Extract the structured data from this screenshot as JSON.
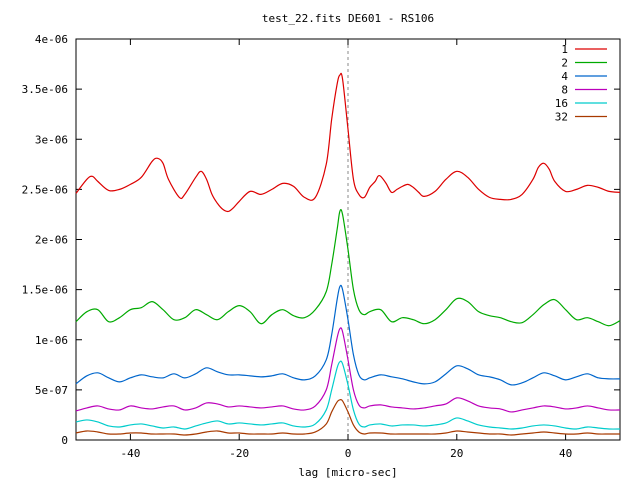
{
  "chart_data": {
    "type": "line",
    "title": "test_22.fits  DE601 - RS106",
    "xlabel": "lag [micro-sec]",
    "ylabel": "",
    "xlim": [
      -50,
      50
    ],
    "ylim": [
      0,
      4e-06
    ],
    "x_ticks": [
      -40,
      -20,
      0,
      20,
      40
    ],
    "x_tick_labels": [
      "-40",
      "-20",
      "0",
      "20",
      "40"
    ],
    "y_ticks": [
      0,
      5e-07,
      1e-06,
      1.5e-06,
      2e-06,
      2.5e-06,
      3e-06,
      3.5e-06,
      4e-06
    ],
    "y_tick_labels": [
      "0",
      "5e-07",
      "1e-06",
      "1.5e-06",
      "2e-06",
      "2.5e-06",
      "3e-06",
      "3.5e-06",
      "4e-06"
    ],
    "zero_line": true,
    "grid": false,
    "legend_position": "top-right",
    "series": [
      {
        "name": "1",
        "color": "#dd0000",
        "x": [
          -50,
          -48,
          -47,
          -46,
          -44,
          -42,
          -40,
          -38,
          -36,
          -35,
          -34,
          -33,
          -31,
          -30,
          -28,
          -27,
          -26,
          -25,
          -24,
          -23,
          -22,
          -21,
          -20,
          -18,
          -16,
          -14,
          -12,
          -10,
          -8,
          -6,
          -4,
          -3,
          -2,
          -1.5,
          -1,
          0,
          1,
          2,
          3,
          4,
          5,
          5.5,
          6,
          7,
          8,
          9,
          10,
          11,
          12,
          13,
          14,
          16,
          18,
          20,
          22,
          24,
          26,
          28,
          30,
          32,
          34,
          35,
          36,
          37,
          38,
          40,
          42,
          44,
          46,
          48,
          50
        ],
        "y": [
          2.46e-06,
          2.6e-06,
          2.63e-06,
          2.58e-06,
          2.49e-06,
          2.5e-06,
          2.55e-06,
          2.62e-06,
          2.78e-06,
          2.81e-06,
          2.76e-06,
          2.6e-06,
          2.42e-06,
          2.45e-06,
          2.62e-06,
          2.68e-06,
          2.6e-06,
          2.45e-06,
          2.36e-06,
          2.3e-06,
          2.28e-06,
          2.32e-06,
          2.38e-06,
          2.48e-06,
          2.45e-06,
          2.5e-06,
          2.56e-06,
          2.53e-06,
          2.42e-06,
          2.42e-06,
          2.75e-06,
          3.2e-06,
          3.55e-06,
          3.64e-06,
          3.6e-06,
          3.1e-06,
          2.6e-06,
          2.45e-06,
          2.42e-06,
          2.52e-06,
          2.58e-06,
          2.63e-06,
          2.63e-06,
          2.56e-06,
          2.47e-06,
          2.5e-06,
          2.53e-06,
          2.55e-06,
          2.52e-06,
          2.47e-06,
          2.43e-06,
          2.48e-06,
          2.6e-06,
          2.68e-06,
          2.62e-06,
          2.5e-06,
          2.42e-06,
          2.4e-06,
          2.4e-06,
          2.45e-06,
          2.6e-06,
          2.72e-06,
          2.76e-06,
          2.7e-06,
          2.58e-06,
          2.48e-06,
          2.5e-06,
          2.54e-06,
          2.52e-06,
          2.48e-06,
          2.47e-06
        ]
      },
      {
        "name": "2",
        "color": "#00aa00",
        "x": [
          -50,
          -48,
          -46,
          -44,
          -42,
          -40,
          -38,
          -36,
          -34,
          -32,
          -30,
          -28,
          -26,
          -24,
          -22,
          -20,
          -18,
          -16,
          -14,
          -12,
          -10,
          -8,
          -6,
          -4,
          -3,
          -2,
          -1.5,
          -1,
          0,
          1,
          2,
          3,
          4,
          6,
          8,
          10,
          12,
          14,
          16,
          18,
          20,
          22,
          24,
          26,
          28,
          30,
          32,
          34,
          36,
          38,
          40,
          42,
          44,
          46,
          48,
          50
        ],
        "y": [
          1.18e-06,
          1.28e-06,
          1.3e-06,
          1.18e-06,
          1.22e-06,
          1.3e-06,
          1.32e-06,
          1.38e-06,
          1.3e-06,
          1.2e-06,
          1.22e-06,
          1.3e-06,
          1.25e-06,
          1.2e-06,
          1.28e-06,
          1.34e-06,
          1.28e-06,
          1.16e-06,
          1.25e-06,
          1.3e-06,
          1.24e-06,
          1.22e-06,
          1.3e-06,
          1.48e-06,
          1.75e-06,
          2.1e-06,
          2.28e-06,
          2.25e-06,
          1.9e-06,
          1.5e-06,
          1.3e-06,
          1.25e-06,
          1.28e-06,
          1.3e-06,
          1.18e-06,
          1.22e-06,
          1.2e-06,
          1.16e-06,
          1.2e-06,
          1.3e-06,
          1.41e-06,
          1.38e-06,
          1.28e-06,
          1.24e-06,
          1.22e-06,
          1.18e-06,
          1.17e-06,
          1.25e-06,
          1.35e-06,
          1.4e-06,
          1.3e-06,
          1.2e-06,
          1.22e-06,
          1.18e-06,
          1.14e-06,
          1.19e-06
        ]
      },
      {
        "name": "4",
        "color": "#0066cc",
        "x": [
          -50,
          -48,
          -46,
          -44,
          -42,
          -40,
          -38,
          -36,
          -34,
          -32,
          -30,
          -28,
          -26,
          -24,
          -22,
          -20,
          -18,
          -16,
          -14,
          -12,
          -10,
          -8,
          -6,
          -4,
          -3,
          -2,
          -1.5,
          -1,
          0,
          1,
          2,
          3,
          4,
          6,
          8,
          10,
          12,
          14,
          16,
          18,
          20,
          22,
          24,
          26,
          28,
          30,
          32,
          34,
          36,
          38,
          40,
          42,
          44,
          46,
          48,
          50
        ],
        "y": [
          5.6e-07,
          6.4e-07,
          6.7e-07,
          6.2e-07,
          5.8e-07,
          6.2e-07,
          6.5e-07,
          6.3e-07,
          6.2e-07,
          6.6e-07,
          6.2e-07,
          6.6e-07,
          7.2e-07,
          6.8e-07,
          6.5e-07,
          6.5e-07,
          6.4e-07,
          6.3e-07,
          6.4e-07,
          6.6e-07,
          6.2e-07,
          6e-07,
          6.4e-07,
          8e-07,
          1.05e-06,
          1.4e-06,
          1.53e-06,
          1.5e-06,
          1.2e-06,
          8.5e-07,
          6.5e-07,
          6e-07,
          6.2e-07,
          6.5e-07,
          6.3e-07,
          6.1e-07,
          5.8e-07,
          5.6e-07,
          5.8e-07,
          6.6e-07,
          7.4e-07,
          7.1e-07,
          6.5e-07,
          6.3e-07,
          6e-07,
          5.5e-07,
          5.7e-07,
          6.2e-07,
          6.7e-07,
          6.4e-07,
          6e-07,
          6.3e-07,
          6.6e-07,
          6.2e-07,
          6.1e-07,
          6.1e-07
        ]
      },
      {
        "name": "8",
        "color": "#bb00bb",
        "x": [
          -50,
          -48,
          -46,
          -44,
          -42,
          -40,
          -38,
          -36,
          -34,
          -32,
          -30,
          -28,
          -26,
          -24,
          -22,
          -20,
          -18,
          -16,
          -14,
          -12,
          -10,
          -8,
          -6,
          -4,
          -3,
          -2,
          -1.5,
          -1,
          0,
          1,
          2,
          3,
          4,
          6,
          8,
          10,
          12,
          14,
          16,
          18,
          20,
          22,
          24,
          26,
          28,
          30,
          32,
          34,
          36,
          38,
          40,
          42,
          44,
          46,
          48,
          50
        ],
        "y": [
          2.9e-07,
          3.2e-07,
          3.4e-07,
          3.1e-07,
          3e-07,
          3.4e-07,
          3.2e-07,
          3.1e-07,
          3.3e-07,
          3.4e-07,
          3e-07,
          3.2e-07,
          3.7e-07,
          3.6e-07,
          3.3e-07,
          3.4e-07,
          3.3e-07,
          3.2e-07,
          3.3e-07,
          3.4e-07,
          3.1e-07,
          3e-07,
          3.4e-07,
          5e-07,
          7.5e-07,
          1.02e-06,
          1.11e-06,
          1.08e-06,
          8e-07,
          5e-07,
          3.5e-07,
          3.2e-07,
          3.4e-07,
          3.5e-07,
          3.3e-07,
          3.2e-07,
          3.1e-07,
          3.2e-07,
          3.4e-07,
          3.6e-07,
          4.2e-07,
          3.9e-07,
          3.4e-07,
          3.2e-07,
          3.1e-07,
          2.8e-07,
          3e-07,
          3.2e-07,
          3.4e-07,
          3.3e-07,
          3.1e-07,
          3.2e-07,
          3.4e-07,
          3.2e-07,
          3e-07,
          3e-07
        ]
      },
      {
        "name": "16",
        "color": "#00cccc",
        "x": [
          -50,
          -48,
          -46,
          -44,
          -42,
          -40,
          -38,
          -36,
          -34,
          -32,
          -30,
          -28,
          -26,
          -24,
          -22,
          -20,
          -18,
          -16,
          -14,
          -12,
          -10,
          -8,
          -6,
          -4,
          -3,
          -2,
          -1.5,
          -1,
          0,
          1,
          2,
          3,
          4,
          6,
          8,
          10,
          12,
          14,
          16,
          18,
          20,
          22,
          24,
          26,
          28,
          30,
          32,
          34,
          36,
          38,
          40,
          42,
          44,
          46,
          48,
          50
        ],
        "y": [
          1.8e-07,
          2e-07,
          1.8e-07,
          1.4e-07,
          1.3e-07,
          1.5e-07,
          1.6e-07,
          1.4e-07,
          1.2e-07,
          1.3e-07,
          1.1e-07,
          1.4e-07,
          1.7e-07,
          1.9e-07,
          1.6e-07,
          1.7e-07,
          1.6e-07,
          1.5e-07,
          1.6e-07,
          1.7e-07,
          1.4e-07,
          1.3e-07,
          1.6e-07,
          3e-07,
          5e-07,
          7.2e-07,
          7.8e-07,
          7.6e-07,
          5.5e-07,
          3e-07,
          1.6e-07,
          1.3e-07,
          1.5e-07,
          1.6e-07,
          1.4e-07,
          1.5e-07,
          1.5e-07,
          1.4e-07,
          1.5e-07,
          1.7e-07,
          2.2e-07,
          1.9e-07,
          1.5e-07,
          1.3e-07,
          1.2e-07,
          1.1e-07,
          1.2e-07,
          1.4e-07,
          1.5e-07,
          1.4e-07,
          1.2e-07,
          1.1e-07,
          1.3e-07,
          1.2e-07,
          1.1e-07,
          1.1e-07
        ]
      },
      {
        "name": "32",
        "color": "#a83a00",
        "x": [
          -50,
          -48,
          -46,
          -44,
          -42,
          -40,
          -38,
          -36,
          -34,
          -32,
          -30,
          -28,
          -26,
          -24,
          -22,
          -20,
          -18,
          -16,
          -14,
          -12,
          -10,
          -8,
          -6,
          -4,
          -3,
          -2,
          -1.5,
          -1,
          0,
          1,
          2,
          3,
          4,
          6,
          8,
          10,
          12,
          14,
          16,
          18,
          20,
          22,
          24,
          26,
          28,
          30,
          32,
          34,
          36,
          38,
          40,
          42,
          44,
          46,
          48,
          50
        ],
        "y": [
          7e-08,
          9e-08,
          8e-08,
          6e-08,
          6e-08,
          7e-08,
          7e-08,
          6e-08,
          6e-08,
          6e-08,
          5e-08,
          6e-08,
          8e-08,
          9e-08,
          7e-08,
          7e-08,
          6e-08,
          6e-08,
          6e-08,
          7e-08,
          6e-08,
          6e-08,
          8e-08,
          1.6e-07,
          2.8e-07,
          3.8e-07,
          4e-07,
          3.9e-07,
          2.8e-07,
          1.5e-07,
          8e-08,
          6e-08,
          7e-08,
          7e-08,
          6e-08,
          6e-08,
          6e-08,
          6e-08,
          6e-08,
          7e-08,
          9e-08,
          8e-08,
          7e-08,
          6e-08,
          6e-08,
          5e-08,
          6e-08,
          7e-08,
          8e-08,
          7e-08,
          6e-08,
          6e-08,
          7e-08,
          6e-08,
          6e-08,
          6e-08
        ]
      }
    ]
  }
}
